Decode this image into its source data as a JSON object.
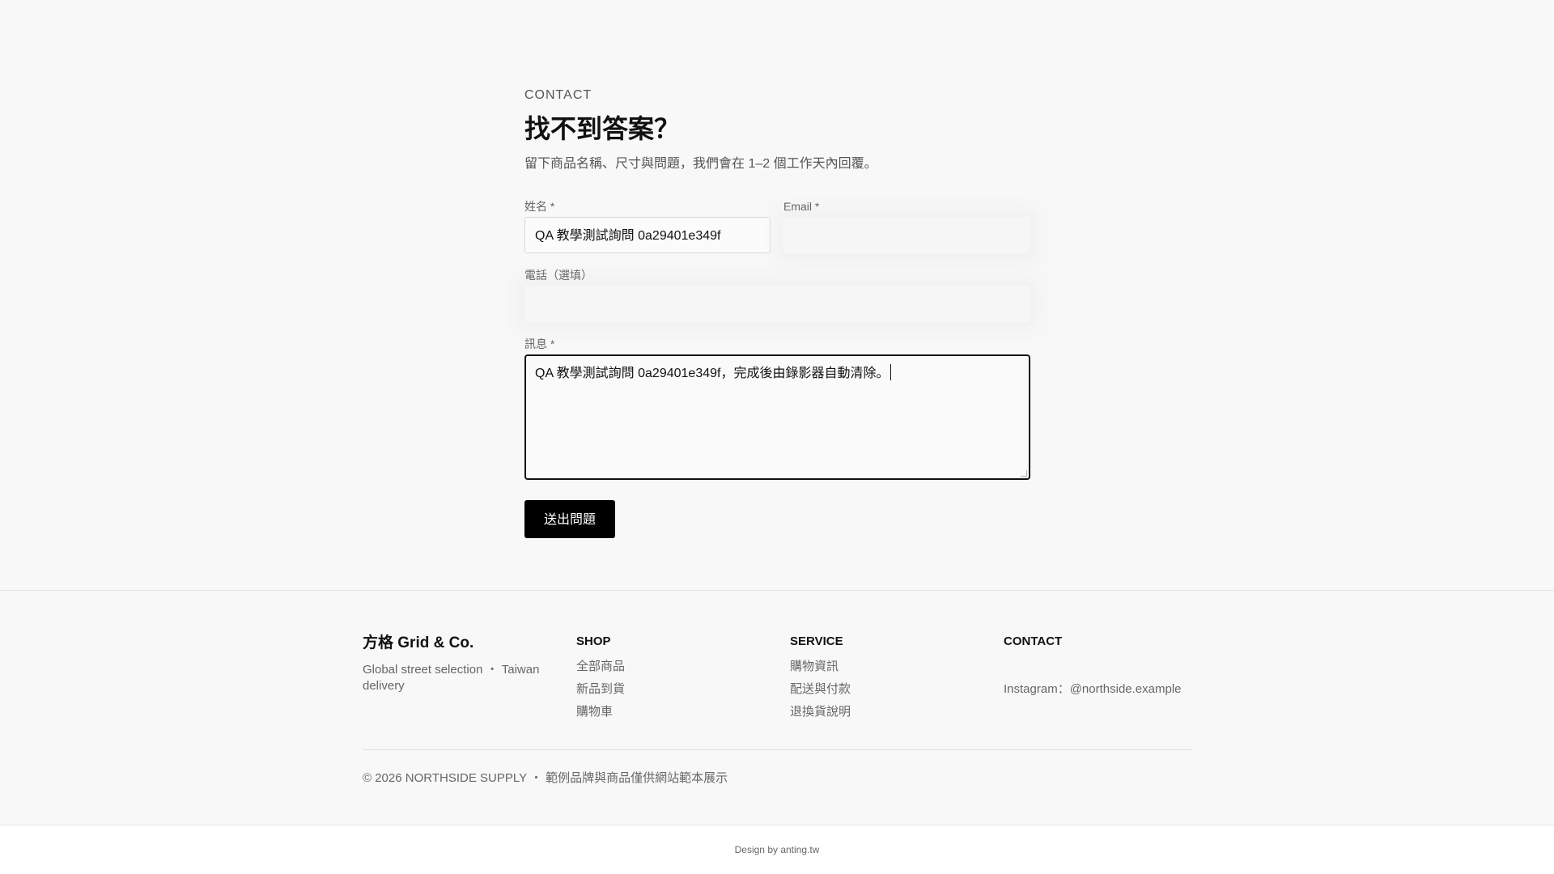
{
  "contact": {
    "eyebrow": "CONTACT",
    "title": "找不到答案？",
    "lead": "留下商品名稱、尺寸與問題，我們會在 1–2 個工作天內回覆。"
  },
  "form": {
    "name_label": "姓名 *",
    "name_value": "QA 教學測試詢問 0a29401e349f",
    "email_label": "Email *",
    "email_value": "",
    "phone_label": "電話（選填）",
    "phone_value": "",
    "message_label": "訊息 *",
    "message_value": "QA 教學測試詢問 0a29401e349f，完成後由錄影器自動清除。",
    "submit_label": "送出問題"
  },
  "footer": {
    "brand_name": "方格 Grid & Co.",
    "brand_tagline": "Global street selection ・ Taiwan delivery",
    "shop_title": "SHOP",
    "shop_links": [
      "全部商品",
      "新品到貨",
      "購物車"
    ],
    "service_title": "SERVICE",
    "service_links": [
      "購物資訊",
      "配送與付款",
      "退換貨說明"
    ],
    "contact_title": "CONTACT",
    "contact_line": "Instagram：@northside.example",
    "copyright": "© 2026 NORTHSIDE SUPPLY ・ 範例品牌與商品僅供網站範本展示",
    "credit": "Design by anting.tw"
  }
}
